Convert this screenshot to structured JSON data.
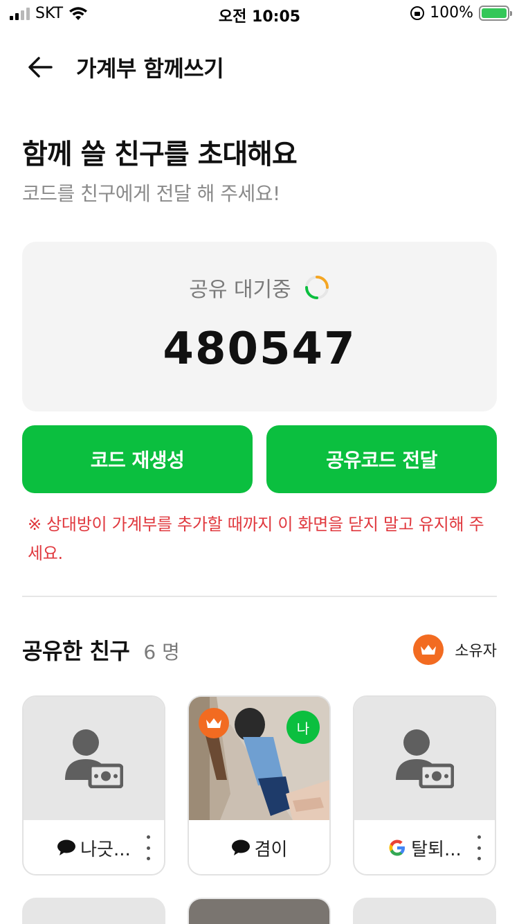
{
  "status_bar": {
    "carrier": "SKT",
    "time": "오전 10:05",
    "battery_text": "100%"
  },
  "header": {
    "title": "가계부 함께쓰기"
  },
  "invite": {
    "headline": "함께 쓸 친구를 초대해요",
    "subline": "코드를 친구에게 전달 해 주세요!",
    "status": "공유 대기중",
    "code": "480547",
    "regen_label": "코드 재생성",
    "send_label": "공유코드 전달",
    "warning": "※ 상대방이 가계부를 추가할 때까지 이 화면을 닫지 말고 유지해 주세요."
  },
  "friends": {
    "title": "공유한 친구",
    "count": "6 명",
    "owner_legend": "소유자",
    "items": [
      {
        "name": "나긋...",
        "source_icon": "kakao-talk-icon",
        "avatar": "person-money-icon"
      },
      {
        "name": "겸이",
        "source_icon": "kakao-talk-icon",
        "avatar": "photo",
        "me_badge": "나"
      },
      {
        "name": "탈퇴...",
        "source_icon": "google-icon",
        "avatar": "person-money-icon"
      }
    ]
  },
  "colors": {
    "accent_green": "#0bbf3f",
    "warning_red": "#e0383e",
    "owner_orange": "#f26b21"
  }
}
